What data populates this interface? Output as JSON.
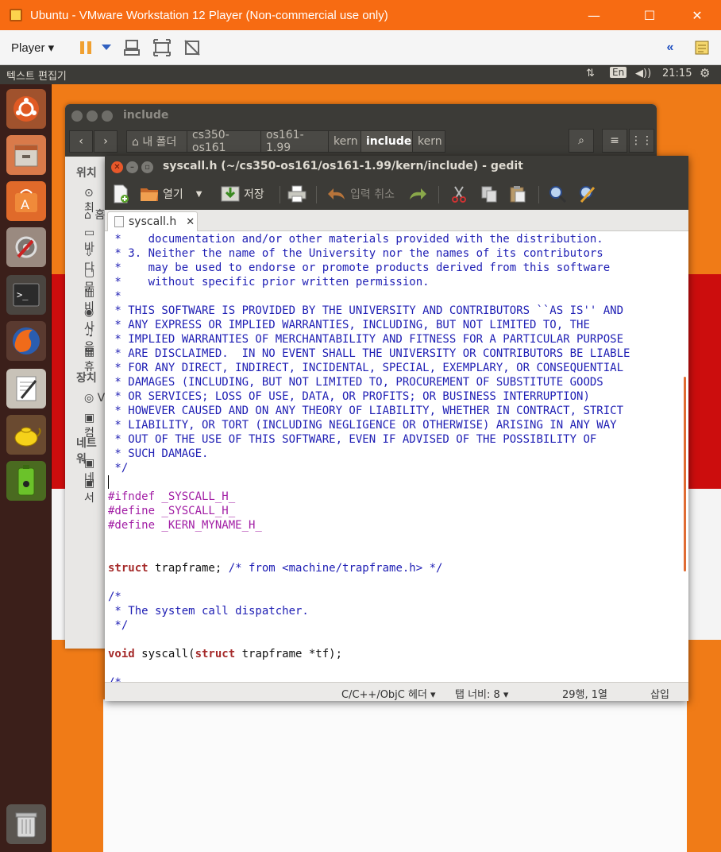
{
  "vmware": {
    "title": "Ubuntu - VMware Workstation 12 Player (Non-commercial use only)",
    "player_menu": "Player ▾",
    "minimize": "—",
    "maximize": "☐",
    "close": "✕"
  },
  "panel": {
    "app_name": "텍스트 편집기",
    "keyboard": "En",
    "volume": "◀))",
    "clock": "21:15",
    "network": "⇅",
    "gear": "⚙"
  },
  "nautilus": {
    "title": "include",
    "breadcrumbs": [
      "⌂ 내 폴더",
      "cs350-os161",
      "os161-1.99",
      "kern",
      "include",
      "kern"
    ],
    "active_crumb": 4,
    "sidebar": {
      "places_header": "위치",
      "devices_header": "장치",
      "network_header": "네트워",
      "items": [
        "⊙ 최",
        "⌂ 홈",
        "▭ 바",
        "⇩ 다",
        "▢ 문",
        "▥ 비",
        "◉ 사",
        "♫ 음",
        "▦ 휴"
      ],
      "device_items": [
        "◎ V",
        "▣ 컴"
      ],
      "network_items": [
        "▣ 네",
        "▣ 서"
      ]
    },
    "back": "‹",
    "forward": "›",
    "search": "⌕",
    "menu": "≡",
    "grid": "⋮⋮"
  },
  "gedit": {
    "title": "syscall.h (~/cs350-os161/os161-1.99/kern/include) - gedit",
    "toolbar": {
      "open": "열기",
      "save": "저장",
      "undo": "입력 취소"
    },
    "tab_label": "syscall.h",
    "tab_close": "✕",
    "code_lines": [
      {
        "cls": "c-cm",
        "text": " *    documentation and/or other materials provided with the distribution."
      },
      {
        "cls": "c-cm",
        "text": " * 3. Neither the name of the University nor the names of its contributors"
      },
      {
        "cls": "c-cm",
        "text": " *    may be used to endorse or promote products derived from this software"
      },
      {
        "cls": "c-cm",
        "text": " *    without specific prior written permission."
      },
      {
        "cls": "c-cm",
        "text": " *"
      },
      {
        "cls": "c-cm",
        "text": " * THIS SOFTWARE IS PROVIDED BY THE UNIVERSITY AND CONTRIBUTORS ``AS IS'' AND"
      },
      {
        "cls": "c-cm",
        "text": " * ANY EXPRESS OR IMPLIED WARRANTIES, INCLUDING, BUT NOT LIMITED TO, THE"
      },
      {
        "cls": "c-cm",
        "text": " * IMPLIED WARRANTIES OF MERCHANTABILITY AND FITNESS FOR A PARTICULAR PURPOSE"
      },
      {
        "cls": "c-cm",
        "text": " * ARE DISCLAIMED.  IN NO EVENT SHALL THE UNIVERSITY OR CONTRIBUTORS BE LIABLE"
      },
      {
        "cls": "c-cm",
        "text": " * FOR ANY DIRECT, INDIRECT, INCIDENTAL, SPECIAL, EXEMPLARY, OR CONSEQUENTIAL"
      },
      {
        "cls": "c-cm",
        "text": " * DAMAGES (INCLUDING, BUT NOT LIMITED TO, PROCUREMENT OF SUBSTITUTE GOODS"
      },
      {
        "cls": "c-cm",
        "text": " * OR SERVICES; LOSS OF USE, DATA, OR PROFITS; OR BUSINESS INTERRUPTION)"
      },
      {
        "cls": "c-cm",
        "text": " * HOWEVER CAUSED AND ON ANY THEORY OF LIABILITY, WHETHER IN CONTRACT, STRICT"
      },
      {
        "cls": "c-cm",
        "text": " * LIABILITY, OR TORT (INCLUDING NEGLIGENCE OR OTHERWISE) ARISING IN ANY WAY"
      },
      {
        "cls": "c-cm",
        "text": " * OUT OF THE USE OF THIS SOFTWARE, EVEN IF ADVISED OF THE POSSIBILITY OF"
      },
      {
        "cls": "c-cm",
        "text": " * SUCH DAMAGE."
      },
      {
        "cls": "c-cm",
        "text": " */"
      },
      {
        "cls": "c-tx",
        "text": ""
      },
      {
        "cls": "c-pp",
        "text": "#ifndef _SYSCALL_H_"
      },
      {
        "cls": "c-pp",
        "text": "#define _SYSCALL_H_"
      },
      {
        "cls": "c-pp",
        "text": "#define _KERN_MYNAME_H_"
      },
      {
        "cls": "c-tx",
        "text": ""
      },
      {
        "cls": "c-tx",
        "text": ""
      },
      {
        "cls": "mix1",
        "text": ""
      },
      {
        "cls": "c-tx",
        "text": ""
      },
      {
        "cls": "c-cm",
        "text": "/*"
      },
      {
        "cls": "c-cm",
        "text": " * The system call dispatcher."
      },
      {
        "cls": "c-cm",
        "text": " */"
      },
      {
        "cls": "c-tx",
        "text": ""
      },
      {
        "cls": "mix2",
        "text": ""
      },
      {
        "cls": "c-tx",
        "text": ""
      },
      {
        "cls": "c-cm",
        "text": "/*"
      }
    ],
    "mix1": {
      "kw": "struct",
      "rest": " trapframe; ",
      "cm": "/* from <machine/trapframe.h> */"
    },
    "mix2": {
      "kw1": "void",
      "mid1": " syscall(",
      "kw2": "struct",
      "mid2": " trapframe *tf);"
    },
    "status": {
      "language": "C/C++/ObjC 헤더 ▾",
      "tab_width": "탭 너비: 8 ▾",
      "position": "29행, 1열",
      "mode": "삽입"
    }
  },
  "colors": {
    "accent": "#f76b12",
    "panel": "#3c3b37",
    "comment": "#1e1eb4",
    "preprocessor": "#a21ea5",
    "keyword": "#a52a2a"
  }
}
